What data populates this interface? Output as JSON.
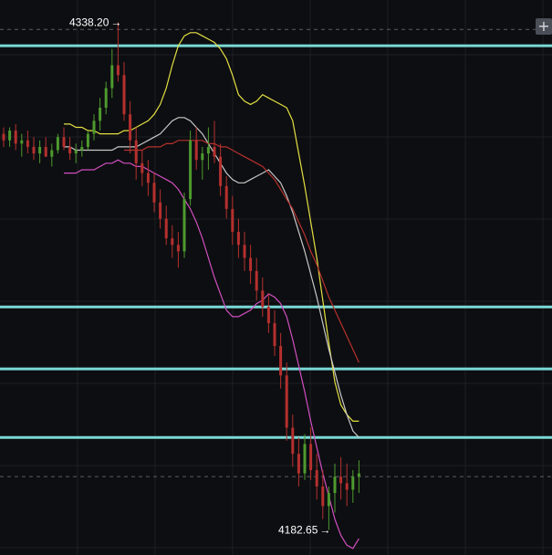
{
  "chart_data": {
    "type": "candlestick",
    "ylim": [
      4175,
      4345
    ],
    "high_marker": {
      "label": "4338.20",
      "value": 4338.2
    },
    "low_marker": {
      "label": "4182.65",
      "value": 4182.65
    },
    "dashed_lines": [
      4336,
      4199
    ],
    "horizontal_lines": [
      4331,
      4251,
      4232,
      4211
    ],
    "horizontal_line_color": "#7ad9d6",
    "grid": true,
    "candles": [
      [
        4304,
        4306,
        4300,
        4302
      ],
      [
        4302,
        4306,
        4300,
        4305
      ],
      [
        4305,
        4307,
        4299,
        4301
      ],
      [
        4301,
        4304,
        4297,
        4302
      ],
      [
        4302,
        4305,
        4298,
        4300
      ],
      [
        4300,
        4303,
        4296,
        4298
      ],
      [
        4298,
        4302,
        4295,
        4300
      ],
      [
        4300,
        4303,
        4297,
        4297
      ],
      [
        4297,
        4301,
        4294,
        4299
      ],
      [
        4299,
        4304,
        4298,
        4303
      ],
      [
        4303,
        4306,
        4299,
        4300
      ],
      [
        4300,
        4303,
        4296,
        4298
      ],
      [
        4298,
        4301,
        4295,
        4299
      ],
      [
        4299,
        4302,
        4297,
        4300
      ],
      [
        4300,
        4305,
        4299,
        4304
      ],
      [
        4304,
        4310,
        4302,
        4308
      ],
      [
        4308,
        4315,
        4305,
        4312
      ],
      [
        4312,
        4320,
        4310,
        4318
      ],
      [
        4318,
        4330,
        4315,
        4325
      ],
      [
        4325,
        4338.2,
        4320,
        4322
      ],
      [
        4322,
        4326,
        4308,
        4310
      ],
      [
        4310,
        4314,
        4298,
        4302
      ],
      [
        4302,
        4306,
        4290,
        4295
      ],
      [
        4295,
        4299,
        4288,
        4292
      ],
      [
        4292,
        4296,
        4285,
        4289
      ],
      [
        4289,
        4292,
        4280,
        4283
      ],
      [
        4283,
        4287,
        4275,
        4278
      ],
      [
        4278,
        4282,
        4270,
        4272
      ],
      [
        4272,
        4276,
        4266,
        4270
      ],
      [
        4270,
        4274,
        4263,
        4268
      ],
      [
        4268,
        4286,
        4266,
        4284
      ],
      [
        4284,
        4305,
        4282,
        4302
      ],
      [
        4302,
        4306,
        4293,
        4296
      ],
      [
        4296,
        4300,
        4290,
        4298
      ],
      [
        4298,
        4306,
        4293,
        4300
      ],
      [
        4300,
        4308,
        4295,
        4297
      ],
      [
        4297,
        4301,
        4285,
        4288
      ],
      [
        4288,
        4291,
        4278,
        4281
      ],
      [
        4281,
        4285,
        4270,
        4274
      ],
      [
        4274,
        4278,
        4266,
        4270
      ],
      [
        4270,
        4274,
        4262,
        4266
      ],
      [
        4266,
        4270,
        4258,
        4262
      ],
      [
        4262,
        4266,
        4253,
        4256
      ],
      [
        4256,
        4260,
        4248,
        4251
      ],
      [
        4251,
        4255,
        4243,
        4246
      ],
      [
        4246,
        4250,
        4236,
        4239
      ],
      [
        4239,
        4243,
        4226,
        4230
      ],
      [
        4230,
        4234,
        4210,
        4214
      ],
      [
        4214,
        4218,
        4202,
        4206
      ],
      [
        4206,
        4211,
        4196,
        4200
      ],
      [
        4200,
        4212,
        4198,
        4209
      ],
      [
        4209,
        4214,
        4198,
        4201
      ],
      [
        4201,
        4206,
        4192,
        4196
      ],
      [
        4196,
        4201,
        4186,
        4190
      ],
      [
        4190,
        4196,
        4182.65,
        4194
      ],
      [
        4194,
        4203,
        4188,
        4199
      ],
      [
        4199,
        4205,
        4192,
        4197
      ],
      [
        4197,
        4203,
        4190,
        4195
      ],
      [
        4195,
        4201,
        4191,
        4199
      ],
      [
        4199,
        4204,
        4194,
        4200
      ]
    ],
    "bollinger_upper": [
      4307,
      4307,
      4306,
      4306,
      4305,
      4305,
      4304,
      4304,
      4304,
      4304,
      4305,
      4305,
      4306,
      4307,
      4308,
      4310,
      4313,
      4318,
      4325,
      4331,
      4334,
      4335,
      4335,
      4334,
      4333,
      4332,
      4330,
      4327,
      4322,
      4316,
      4314,
      4313,
      4314,
      4316,
      4315,
      4314,
      4313,
      4312,
      4308,
      4298,
      4288,
      4277,
      4266,
      4253,
      4240,
      4228,
      4221,
      4218,
      4216,
      4216
    ],
    "bollinger_mid": [
      4300,
      4300,
      4299,
      4299,
      4299,
      4299,
      4299,
      4299,
      4299,
      4300,
      4300,
      4300,
      4300,
      4301,
      4302,
      4303,
      4304,
      4306,
      4308,
      4309,
      4309,
      4308,
      4306,
      4304,
      4301,
      4298,
      4295,
      4292,
      4290,
      4289,
      4289,
      4290,
      4291,
      4292,
      4293,
      4291,
      4289,
      4285,
      4280,
      4274,
      4268,
      4261,
      4254,
      4246,
      4238,
      4231,
      4224,
      4218,
      4213,
      4211
    ],
    "bollinger_lower": [
      4292,
      4292,
      4292,
      4293,
      4293,
      4293,
      4294,
      4295,
      4295,
      4296,
      4295,
      4295,
      4294,
      4294,
      4293,
      4292,
      4291,
      4290,
      4289,
      4287,
      4284,
      4281,
      4277,
      4272,
      4266,
      4260,
      4255,
      4250,
      4248,
      4248,
      4249,
      4250,
      4252,
      4253,
      4255,
      4254,
      4252,
      4248,
      4241,
      4233,
      4225,
      4216,
      4208,
      4200,
      4193,
      4186,
      4181,
      4178,
      4177,
      4180
    ],
    "bollinger_start_index": 10,
    "moving_average": [
      4299,
      4299,
      4299,
      4299,
      4300,
      4300,
      4300,
      4301,
      4301,
      4302,
      4302,
      4302,
      4302,
      4302,
      4301,
      4301,
      4300,
      4300,
      4299,
      4298,
      4297,
      4296,
      4295,
      4294,
      4292,
      4290,
      4287,
      4284,
      4281,
      4277,
      4273,
      4268,
      4264,
      4259,
      4254,
      4250,
      4246,
      4242,
      4238,
      4234
    ],
    "moving_average_start_index": 20,
    "colors": {
      "background": "#0d0e11",
      "grid": "#1d1f24",
      "up": "#4e9a2e",
      "down": "#b5302e",
      "upper_band": "#e3e043",
      "mid_band": "#c8c8c8",
      "lower_band": "#d24fc0",
      "moving_average": "#b7312c",
      "dashed": "#5a5f66",
      "marker_text": "#ffffff"
    }
  },
  "toolbar": {
    "add_icon": "+"
  }
}
